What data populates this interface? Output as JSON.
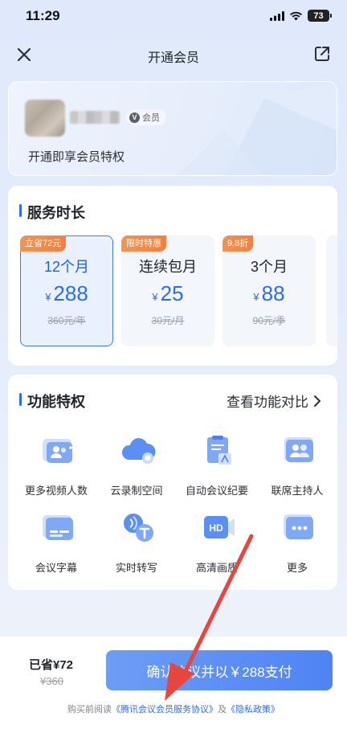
{
  "status": {
    "time": "11:29",
    "battery": "73"
  },
  "nav": {
    "title": "开通会员",
    "close_icon": "close-icon",
    "share_icon": "share-icon"
  },
  "user": {
    "vip_tag": "会员",
    "subtitle": "开通即享会员特权"
  },
  "service": {
    "title": "服务时长",
    "plans": [
      {
        "badge": "立省72元",
        "name": "12个月",
        "currency": "¥",
        "price": "288",
        "original": "360元/年",
        "selected": true
      },
      {
        "badge": "限时特惠",
        "name": "连续包月",
        "currency": "¥",
        "price": "25",
        "original": "30元/月",
        "selected": false
      },
      {
        "badge": "9.8折",
        "name": "3个月",
        "currency": "¥",
        "price": "88",
        "original": "90元/季",
        "selected": false
      }
    ]
  },
  "features": {
    "title": "功能特权",
    "compare_link": "查看功能对比",
    "items": [
      {
        "label": "更多视频人数",
        "icon": "video-people-icon"
      },
      {
        "label": "云录制空间",
        "icon": "cloud-record-icon"
      },
      {
        "label": "自动会议纪要",
        "icon": "meeting-notes-icon"
      },
      {
        "label": "联席主持人",
        "icon": "co-host-icon"
      },
      {
        "label": "会议字幕",
        "icon": "subtitles-icon"
      },
      {
        "label": "实时转写",
        "icon": "transcribe-icon"
      },
      {
        "label": "高清画质",
        "icon": "hd-icon"
      },
      {
        "label": "更多",
        "icon": "more-icon"
      }
    ]
  },
  "bottom": {
    "saved": "已省¥72",
    "original_total": "¥360",
    "pay_button": "确认协议并以￥288支付",
    "agreement_prefix": "购买前阅读",
    "agreement_link": "《腾讯会议会员服务协议》",
    "agreement_and": "及",
    "privacy_link": "《隐私政策》"
  },
  "colors": {
    "accent": "#2a6cf6",
    "badge": "#f5853f",
    "pay_button": "#5b8ff5",
    "annotation_arrow": "#e8453c"
  }
}
